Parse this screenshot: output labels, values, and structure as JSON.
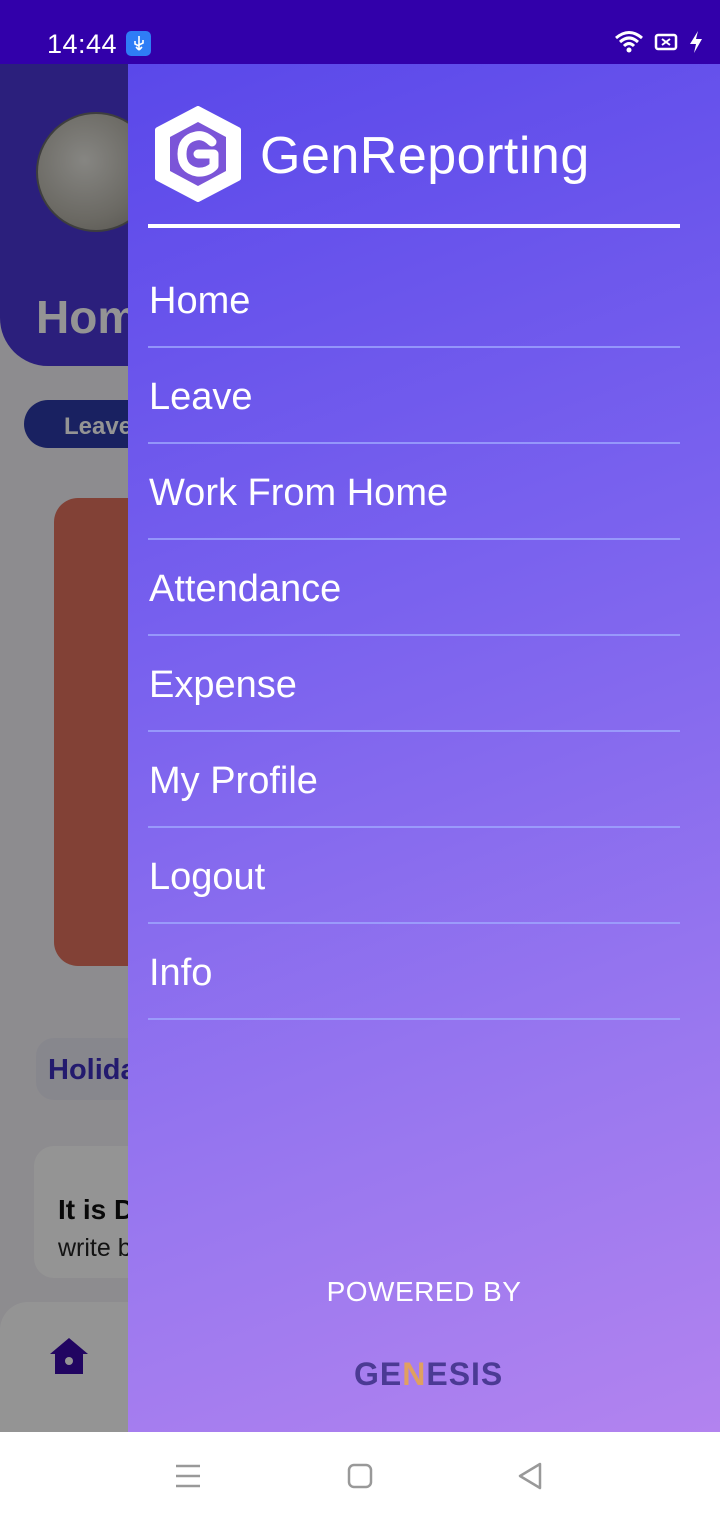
{
  "status_bar": {
    "time": "14:44",
    "icons": [
      "usb-icon",
      "wifi-icon",
      "battery-saver-icon",
      "charging-icon"
    ]
  },
  "background_app": {
    "header_title": "Hom",
    "leave_chip": "Leave",
    "holiday_chip": "Holida",
    "quote_title": "It is D",
    "quote_subtitle": "write b"
  },
  "drawer": {
    "app_name": "GenReporting",
    "menu": [
      {
        "label": "Home"
      },
      {
        "label": "Leave"
      },
      {
        "label": "Work From Home"
      },
      {
        "label": "Attendance"
      },
      {
        "label": "Expense"
      },
      {
        "label": "My Profile"
      },
      {
        "label": "Logout"
      },
      {
        "label": "Info"
      }
    ],
    "powered_by": "POWERED BY",
    "brand_logo_text": "GENESIS"
  },
  "colors": {
    "status_bar": "#3200aa",
    "drawer_gradient_start": "#5a48ea",
    "drawer_gradient_end": "#b283ef",
    "accent": "#4a36d6"
  },
  "system_nav": [
    "menu-icon",
    "home-square-icon",
    "back-triangle-icon"
  ]
}
